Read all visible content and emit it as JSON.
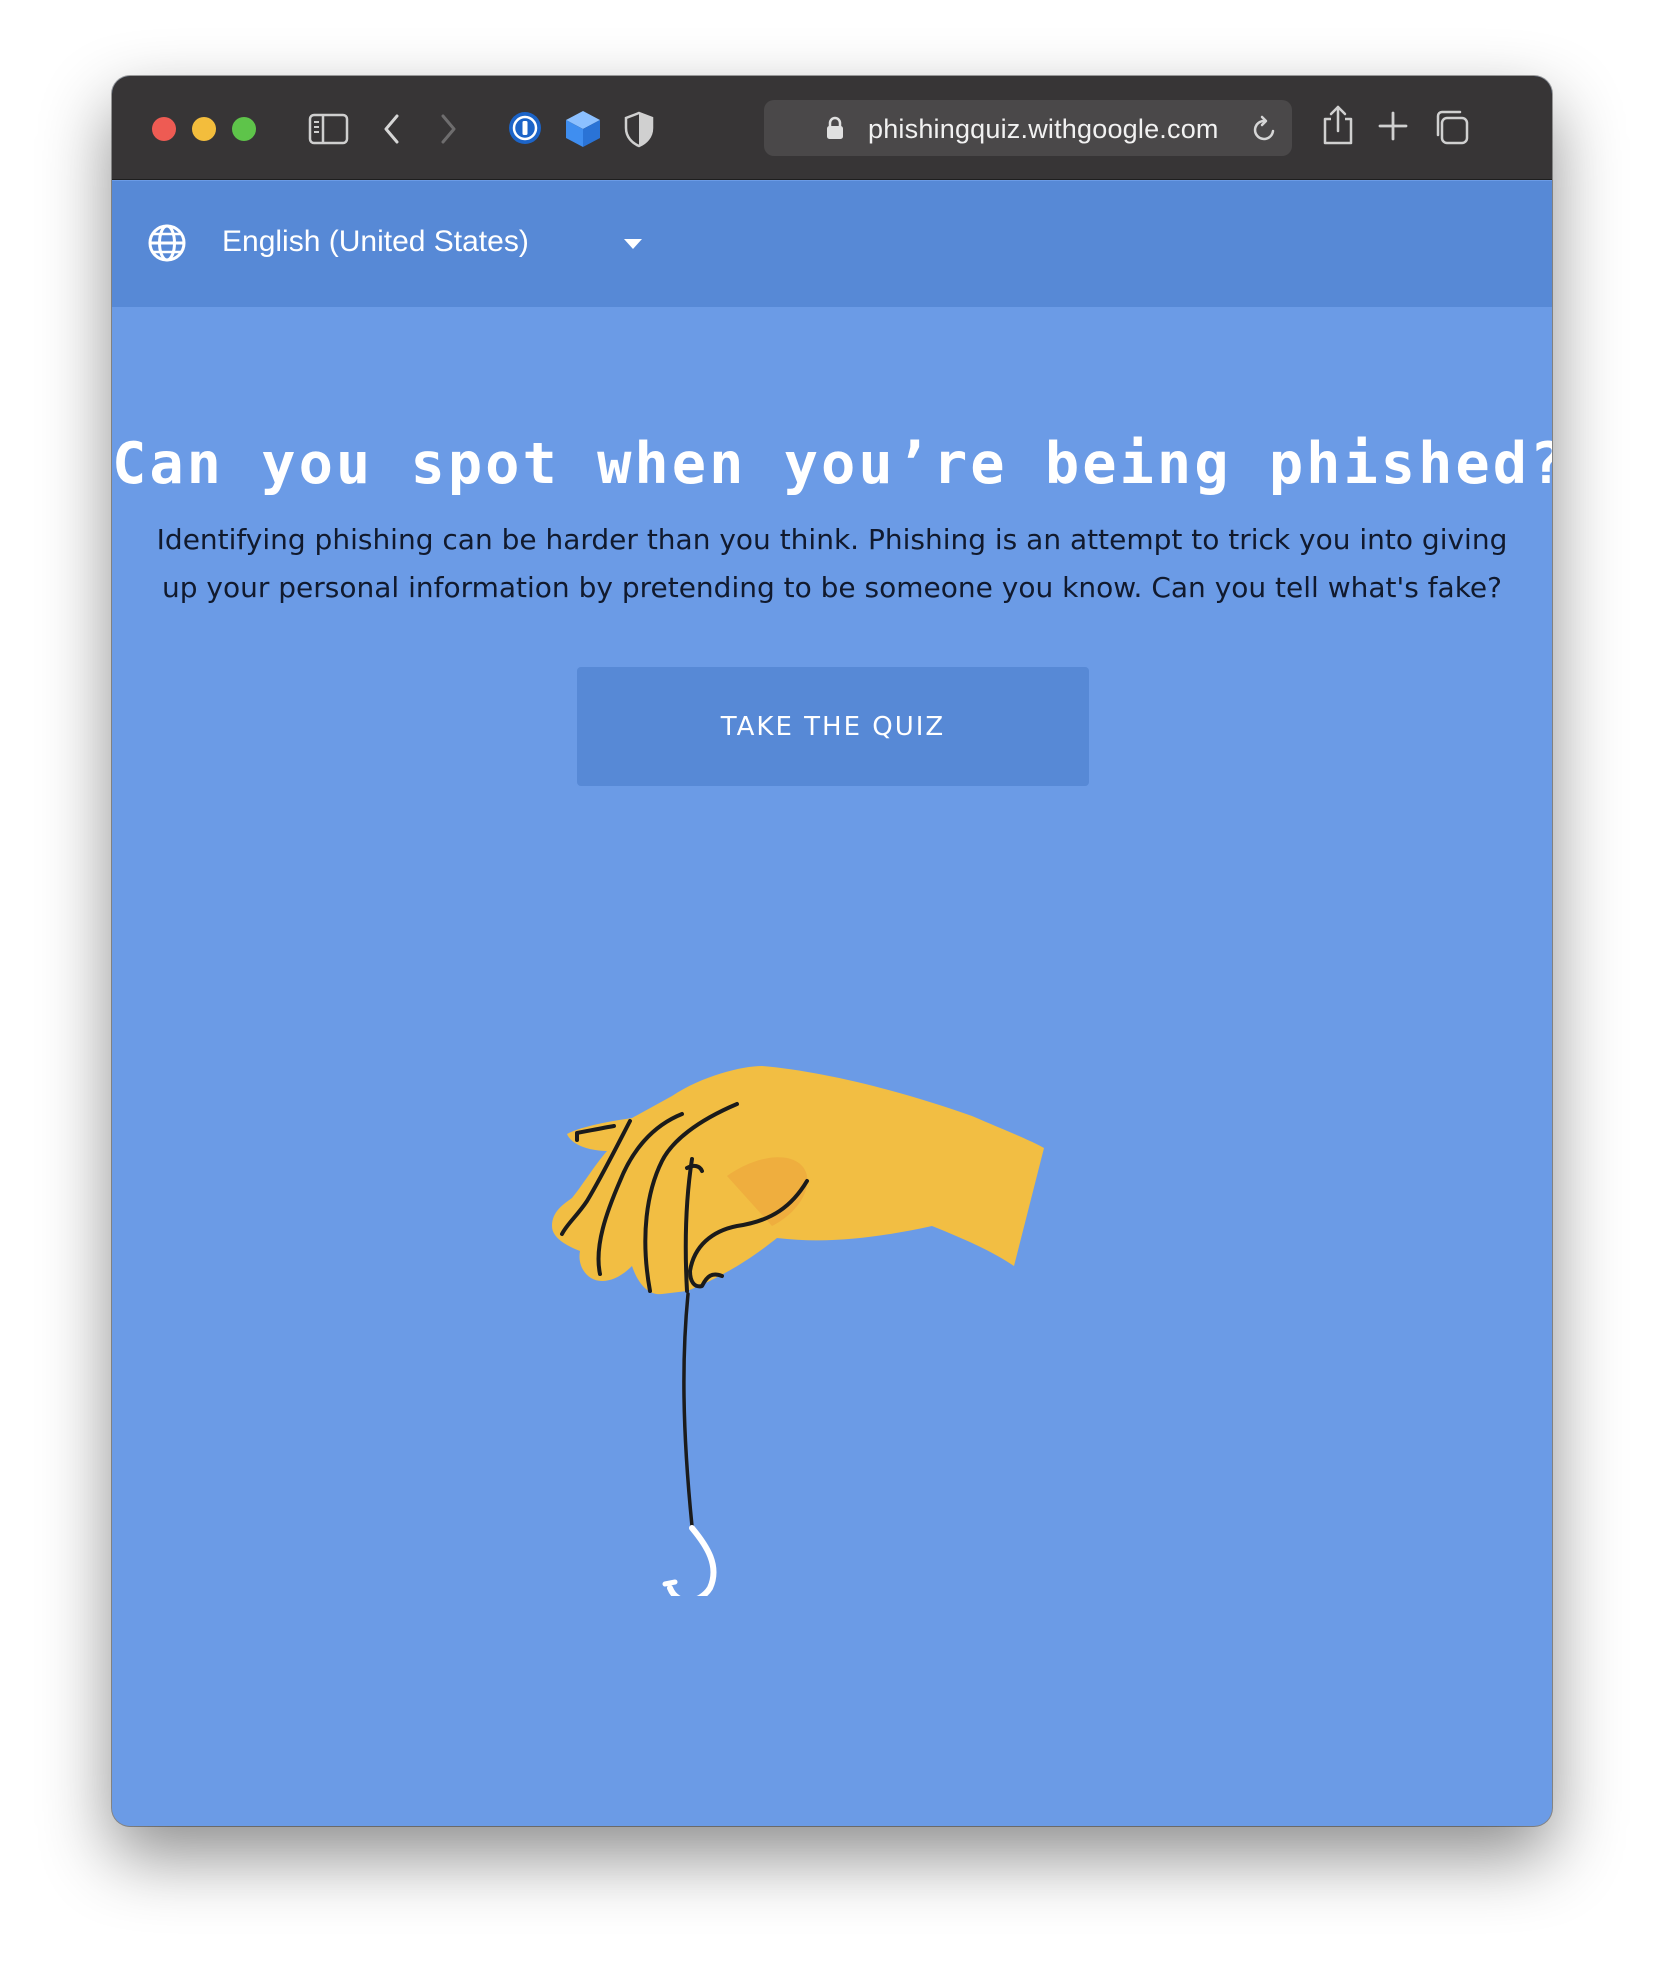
{
  "browser": {
    "url": "phishingquiz.withgoogle.com",
    "icons": [
      "sidebar-icon",
      "back-icon",
      "forward-icon",
      "1password-icon",
      "box-icon",
      "shield-icon",
      "lock-icon",
      "reload-icon",
      "share-icon",
      "new-tab-icon",
      "tabs-overview-icon"
    ]
  },
  "language": {
    "selected": "English (United States)",
    "icon": "globe-icon"
  },
  "hero": {
    "title": "Can you spot when you’re being phished?",
    "description": "Identifying phishing can be harder than you think. Phishing is an attempt to trick you into giving up your personal information by pretending to be someone you know. Can you tell what's fake?",
    "button_label": "TAKE THE QUIZ"
  },
  "colors": {
    "page_background": "#6b9be6",
    "header_background": "#5789d6",
    "button_background": "#5789d6",
    "toolbar_background": "#373536",
    "hand": "#f2be43"
  }
}
